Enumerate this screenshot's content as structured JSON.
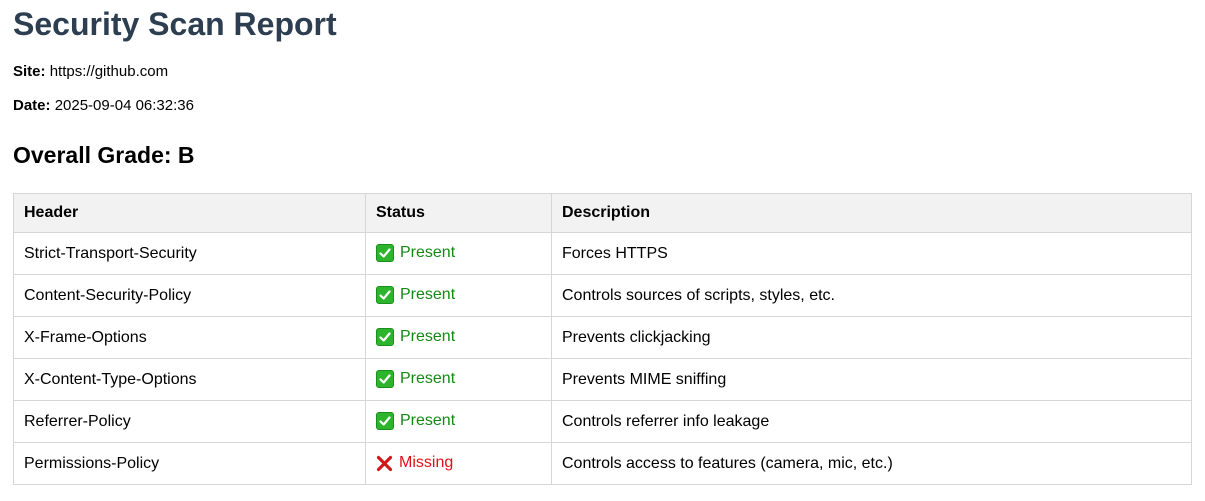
{
  "title": "Security Scan Report",
  "site": {
    "label": "Site:",
    "value": "https://github.com"
  },
  "date": {
    "label": "Date:",
    "value": "2025-09-04 06:32:36"
  },
  "overall_grade": "Overall Grade: B",
  "table": {
    "columns": [
      "Header",
      "Status",
      "Description"
    ],
    "rows": [
      {
        "header": "Strict-Transport-Security",
        "status": "Present",
        "present": true,
        "icon": "check-mark-icon",
        "description": "Forces HTTPS"
      },
      {
        "header": "Content-Security-Policy",
        "status": "Present",
        "present": true,
        "icon": "check-mark-icon",
        "description": "Controls sources of scripts, styles, etc."
      },
      {
        "header": "X-Frame-Options",
        "status": "Present",
        "present": true,
        "icon": "check-mark-icon",
        "description": "Prevents clickjacking"
      },
      {
        "header": "X-Content-Type-Options",
        "status": "Present",
        "present": true,
        "icon": "check-mark-icon",
        "description": "Prevents MIME sniffing"
      },
      {
        "header": "Referrer-Policy",
        "status": "Present",
        "present": true,
        "icon": "check-mark-icon",
        "description": "Controls referrer info leakage"
      },
      {
        "header": "Permissions-Policy",
        "status": "Missing",
        "present": false,
        "icon": "cross-mark-icon",
        "description": "Controls access to features (camera, mic, etc.)"
      }
    ]
  },
  "colors": {
    "title": "#2c3e50",
    "present": "#118a11",
    "missing": "#e0101a",
    "header_bg": "#f2f2f2",
    "border": "#d6d6d6"
  }
}
